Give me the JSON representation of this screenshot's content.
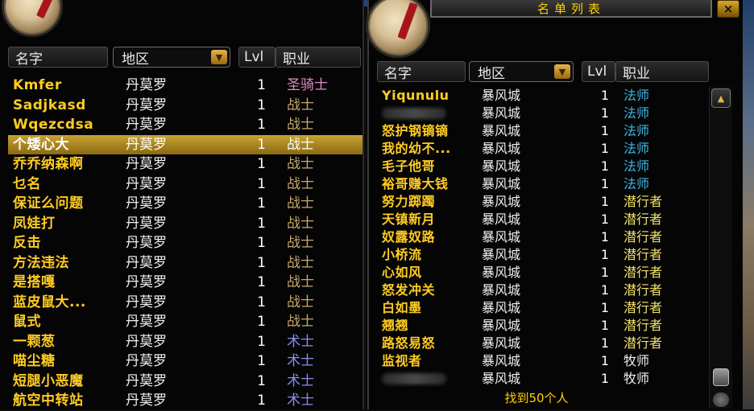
{
  "left": {
    "headers": {
      "name": "名字",
      "zone": "地区",
      "level": "Lvl",
      "class": "职业"
    },
    "rows": [
      {
        "name": "Kmfer",
        "zone": "丹莫罗",
        "level": "1",
        "class": "圣骑士",
        "class_color": "#e38bc4"
      },
      {
        "name": "Sadjkasd",
        "zone": "丹莫罗",
        "level": "1",
        "class": "战士",
        "class_color": "#c9a96b"
      },
      {
        "name": "Wqezcdsa",
        "zone": "丹莫罗",
        "level": "1",
        "class": "战士",
        "class_color": "#c9a96b"
      },
      {
        "name": "个矮心大",
        "zone": "丹莫罗",
        "level": "1",
        "class": "战士",
        "class_color": "#ffffff"
      },
      {
        "name": "乔乔纳森啊",
        "zone": "丹莫罗",
        "level": "1",
        "class": "战士",
        "class_color": "#c9a96b"
      },
      {
        "name": "乜名",
        "zone": "丹莫罗",
        "level": "1",
        "class": "战士",
        "class_color": "#c9a96b"
      },
      {
        "name": "保证么问题",
        "zone": "丹莫罗",
        "level": "1",
        "class": "战士",
        "class_color": "#c9a96b"
      },
      {
        "name": "凤娃打",
        "zone": "丹莫罗",
        "level": "1",
        "class": "战士",
        "class_color": "#c9a96b"
      },
      {
        "name": "反击",
        "zone": "丹莫罗",
        "level": "1",
        "class": "战士",
        "class_color": "#c9a96b"
      },
      {
        "name": "方法违法",
        "zone": "丹莫罗",
        "level": "1",
        "class": "战士",
        "class_color": "#c9a96b"
      },
      {
        "name": "是搭嘎",
        "zone": "丹莫罗",
        "level": "1",
        "class": "战士",
        "class_color": "#c9a96b"
      },
      {
        "name": "蓝皮鼠大...",
        "zone": "丹莫罗",
        "level": "1",
        "class": "战士",
        "class_color": "#c9a96b"
      },
      {
        "name": "鼠式",
        "zone": "丹莫罗",
        "level": "1",
        "class": "战士",
        "class_color": "#c9a96b"
      },
      {
        "name": "一颗葱",
        "zone": "丹莫罗",
        "level": "1",
        "class": "术士",
        "class_color": "#8a8ef0"
      },
      {
        "name": "喵尘糖",
        "zone": "丹莫罗",
        "level": "1",
        "class": "术士",
        "class_color": "#8a8ef0"
      },
      {
        "name": "短腿小恶魔",
        "zone": "丹莫罗",
        "level": "1",
        "class": "术士",
        "class_color": "#8a8ef0"
      },
      {
        "name": "航空中转站",
        "zone": "丹莫罗",
        "level": "1",
        "class": "术士",
        "class_color": "#8a8ef0"
      }
    ],
    "selected_index": 3
  },
  "right": {
    "title": "名单列表",
    "close_label": "×",
    "headers": {
      "name": "名字",
      "zone": "地区",
      "level": "Lvl",
      "class": "职业"
    },
    "rows": [
      {
        "name": "Yiqunulu",
        "zone": "暴风城",
        "level": "1",
        "class": "法师",
        "class_color": "#3fb6e6"
      },
      {
        "name": "",
        "zone": "暴风城",
        "level": "1",
        "class": "法师",
        "class_color": "#3fb6e6",
        "blurred": true
      },
      {
        "name": "怒护钢镝镝",
        "zone": "暴风城",
        "level": "1",
        "class": "法师",
        "class_color": "#3fb6e6"
      },
      {
        "name": "我的幼不...",
        "zone": "暴风城",
        "level": "1",
        "class": "法师",
        "class_color": "#3fb6e6"
      },
      {
        "name": "毛子他哥",
        "zone": "暴风城",
        "level": "1",
        "class": "法师",
        "class_color": "#3fb6e6"
      },
      {
        "name": "裕哥赚大钱",
        "zone": "暴风城",
        "level": "1",
        "class": "法师",
        "class_color": "#3fb6e6"
      },
      {
        "name": "努力踯躅",
        "zone": "暴风城",
        "level": "1",
        "class": "潜行者",
        "class_color": "#f2e26a"
      },
      {
        "name": "天镇新月",
        "zone": "暴风城",
        "level": "1",
        "class": "潜行者",
        "class_color": "#f2e26a"
      },
      {
        "name": "奴露奴路",
        "zone": "暴风城",
        "level": "1",
        "class": "潜行者",
        "class_color": "#f2e26a"
      },
      {
        "name": "小桥流",
        "zone": "暴风城",
        "level": "1",
        "class": "潜行者",
        "class_color": "#f2e26a"
      },
      {
        "name": "心如风",
        "zone": "暴风城",
        "level": "1",
        "class": "潜行者",
        "class_color": "#f2e26a"
      },
      {
        "name": "怒发冲关",
        "zone": "暴风城",
        "level": "1",
        "class": "潜行者",
        "class_color": "#f2e26a"
      },
      {
        "name": "白如墨",
        "zone": "暴风城",
        "level": "1",
        "class": "潜行者",
        "class_color": "#f2e26a"
      },
      {
        "name": "翘翘",
        "zone": "暴风城",
        "level": "1",
        "class": "潜行者",
        "class_color": "#f2e26a"
      },
      {
        "name": "路怒易怒",
        "zone": "暴风城",
        "level": "1",
        "class": "潜行者",
        "class_color": "#f2e26a"
      },
      {
        "name": "监视者",
        "zone": "暴风城",
        "level": "1",
        "class": "牧师",
        "class_color": "#f0f0f0"
      },
      {
        "name": "",
        "zone": "暴风城",
        "level": "1",
        "class": "牧师",
        "class_color": "#f0f0f0",
        "blurred": true
      }
    ],
    "footer": "找到50个人"
  },
  "colors": {
    "name": "#ffcc22",
    "selected": "#c9a233",
    "accent": "#ffd100"
  }
}
